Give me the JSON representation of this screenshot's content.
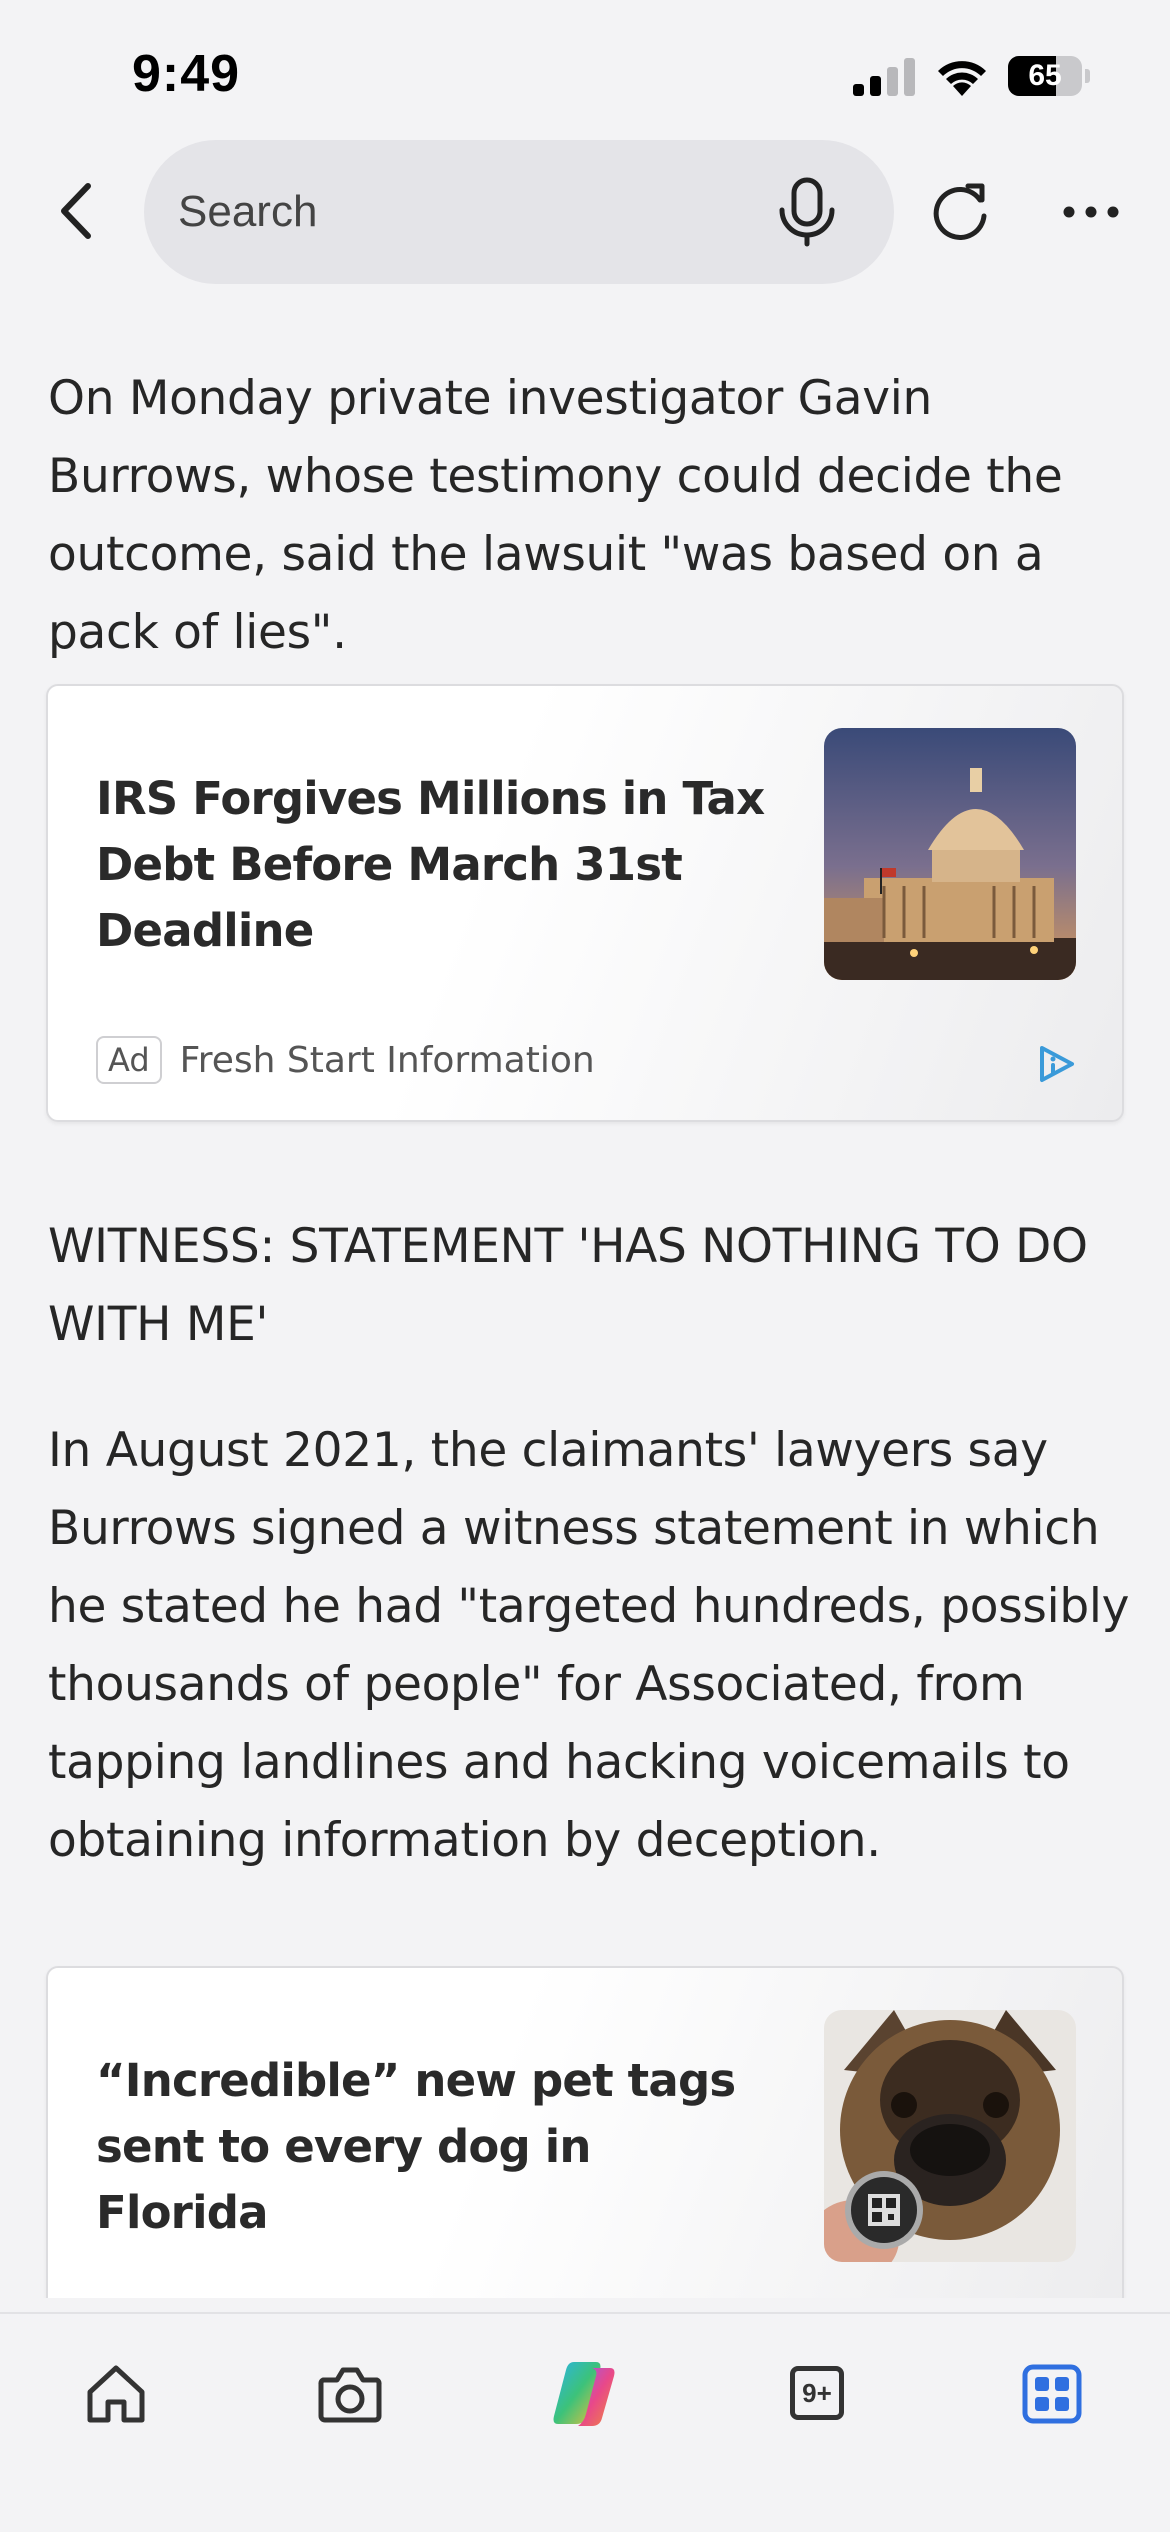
{
  "status_bar": {
    "time": "9:49",
    "battery_level": "65",
    "battery_fraction": 0.65
  },
  "nav": {
    "search_placeholder": "Search",
    "icons": {
      "back": "chevron-left-icon",
      "mic": "microphone-icon",
      "refresh": "refresh-icon",
      "more": "more-horizontal-icon"
    }
  },
  "article": {
    "paragraph_1": "On Monday private investigator Gavin Burrows, whose testimony could decide the outcome, said the lawsuit \"was based on a pack of lies\".",
    "subheading": "WITNESS: STATEMENT 'HAS NOTHING TO DO WITH ME'",
    "paragraph_2": "In August 2021, the claimants' lawyers say Burrows signed a witness statement in which he stated he had \"targeted hundreds, possibly thousands of people\" for Associated, from tapping landlines and hacking voicemails to obtaining information by deception."
  },
  "ads": [
    {
      "title": "IRS Forgives Millions in Tax Debt Before March 31st Deadline",
      "badge": "Ad",
      "source": "Fresh Start Information",
      "image": "capitol-building-at-dusk"
    },
    {
      "title": "“Incredible” new pet tags sent to every dog in Florida",
      "image": "dog-with-qr-pet-tag"
    }
  ],
  "tab_bar": {
    "tabs": [
      {
        "name": "home",
        "icon": "home-icon"
      },
      {
        "name": "camera",
        "icon": "camera-icon"
      },
      {
        "name": "copilot",
        "icon": "copilot-icon"
      },
      {
        "name": "tabs",
        "icon": "tabs-icon",
        "count": "9+"
      },
      {
        "name": "apps",
        "icon": "apps-grid-icon",
        "active": true
      }
    ]
  },
  "colors": {
    "background": "#f3f3f5",
    "search_pill": "#e4e4e8",
    "accent_blue": "#2f6fe0",
    "adchoices_blue": "#3a9ad9"
  }
}
